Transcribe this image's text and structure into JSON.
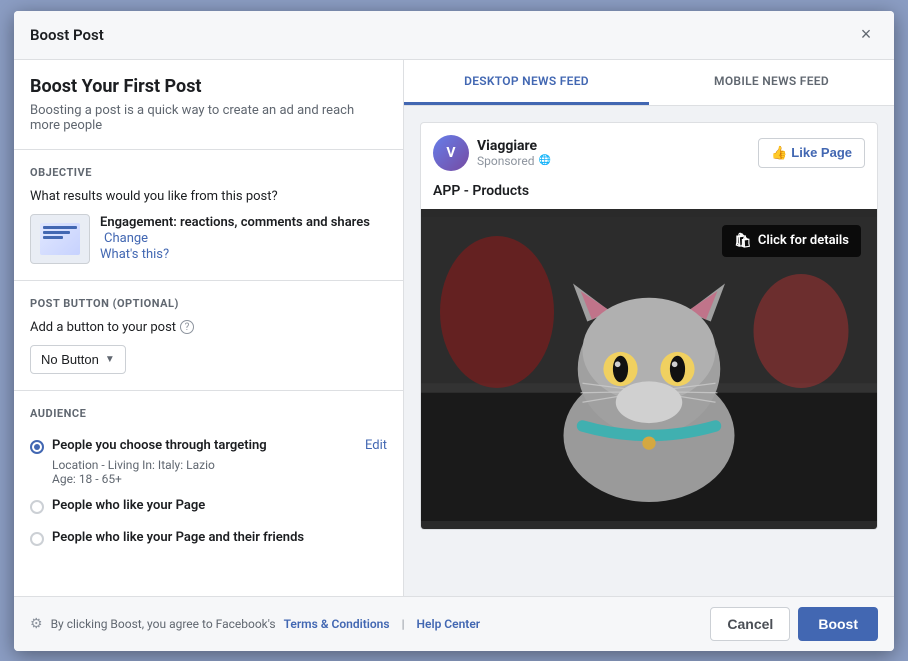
{
  "modal": {
    "title": "Boost Post",
    "close_label": "×"
  },
  "left_panel": {
    "heading": "Boost Your First Post",
    "subheading": "Boosting a post is a quick way to create an ad and reach more people",
    "objective_section": {
      "title": "OBJECTIVE",
      "question": "What results would you like from this post?",
      "objective_name": "Engagement: reactions, comments and shares",
      "change_label": "Change",
      "whats_this_label": "What's this?"
    },
    "post_button_section": {
      "title": "POST BUTTON (Optional)",
      "label": "Add a button to your post",
      "button_label": "No Button"
    },
    "audience_section": {
      "title": "AUDIENCE",
      "options": [
        {
          "label": "People you choose through targeting",
          "selected": true,
          "edit_label": "Edit",
          "detail_line1": "Location - Living In: Italy: Lazio",
          "detail_line2": "Age: 18 - 65+"
        },
        {
          "label": "People who like your Page",
          "selected": false
        },
        {
          "label": "People who like your Page and their friends",
          "selected": false
        }
      ]
    }
  },
  "right_panel": {
    "tabs": [
      {
        "label": "DESKTOP NEWS FEED",
        "active": true
      },
      {
        "label": "MOBILE NEWS FEED",
        "active": false
      }
    ],
    "preview": {
      "page_name": "Viaggiare",
      "sponsored_text": "Sponsored",
      "like_button_label": "Like Page",
      "post_text": "APP - Products",
      "click_for_details": "Click for details"
    }
  },
  "footer": {
    "gear_text": "⚙",
    "consent_text": "By clicking Boost, you agree to Facebook's",
    "terms_label": "Terms & Conditions",
    "separator": "|",
    "help_label": "Help Center",
    "cancel_label": "Cancel",
    "boost_label": "Boost"
  }
}
